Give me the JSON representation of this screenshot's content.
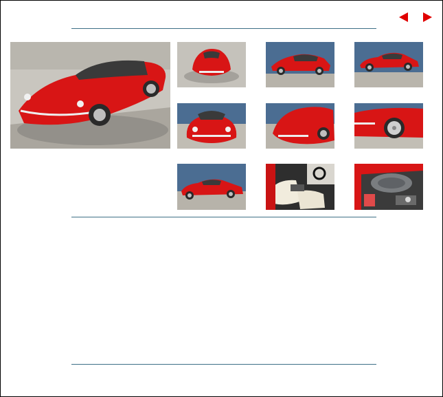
{
  "nav": {
    "prev_icon": "triangle-left-icon",
    "next_icon": "triangle-right-icon",
    "arrow_color": "#e00000"
  },
  "gallery": {
    "main_photo": "red-coupe-front-three-quarter",
    "thumbnails": [
      "red-coupe-top-front-view",
      "red-coupe-side-blue-wall",
      "red-coupe-side-far",
      "red-coupe-front-view",
      "red-coupe-front-detail",
      "red-coupe-wheel-detail",
      "red-coupe-side-wide",
      "red-coupe-interior",
      "red-coupe-engine-bay"
    ]
  },
  "colors": {
    "rule": "#3d6f86",
    "car_red": "#d81515",
    "wall_blue": "#4b6d92"
  }
}
